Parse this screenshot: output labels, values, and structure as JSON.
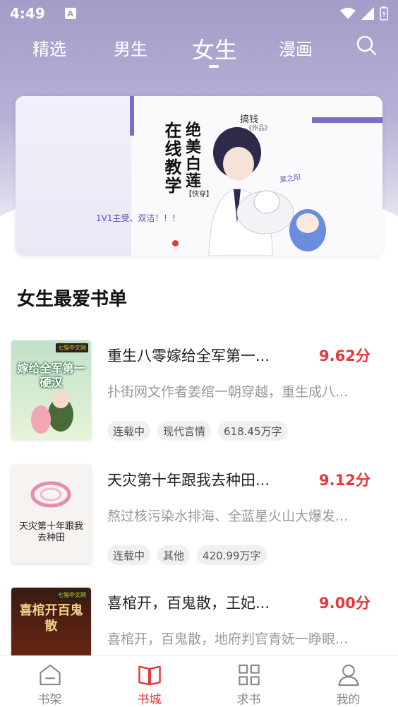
{
  "status": {
    "time": "4:49"
  },
  "top_tabs": [
    {
      "label": "精选"
    },
    {
      "label": "男生"
    },
    {
      "label": "女生"
    },
    {
      "label": "漫画"
    }
  ],
  "banner": {
    "author": "搞钱",
    "author_sub": "《作品》",
    "title_line1": "绝美白莲",
    "title_line2": "在线教学",
    "title_tag": "【快穿】",
    "pen_name": "莫之阳",
    "slogan": "1V1主受、双洁！！！"
  },
  "section": {
    "title": "女生最爱书单"
  },
  "books": [
    {
      "title": "重生八零嫁给全军第一...",
      "score": "9.62分",
      "desc": "扑街网文作者姜绾一朝穿越，重生成八...",
      "tags": [
        "连载中",
        "现代言情",
        "618.45万字"
      ],
      "cover_text": "嫁给全军第一硬汉",
      "cover_badge": "七猫中文网"
    },
    {
      "title": "天灾第十年跟我去种田...",
      "score": "9.12分",
      "desc": "熬过核污染水排海、全蓝星火山大爆发...",
      "tags": [
        "连载中",
        "其他",
        "420.99万字"
      ],
      "cover_text": "天灾第十年跟我去种田"
    },
    {
      "title": "喜棺开，百鬼散，王妃...",
      "score": "9.00分",
      "desc": "喜棺开，百鬼散，地府判官青妩一睁眼...",
      "tags": [],
      "cover_text": "喜棺开百鬼散",
      "cover_badge": "七猫中文网"
    }
  ],
  "bottom_nav": [
    {
      "label": "书架",
      "icon": "bookshelf-icon"
    },
    {
      "label": "书城",
      "icon": "book-open-icon"
    },
    {
      "label": "求书",
      "icon": "grid-icon"
    },
    {
      "label": "我的",
      "icon": "user-icon"
    }
  ],
  "colors": {
    "accent": "#e5383b",
    "banner_purple": "#7b6ec6",
    "header_bg": "#a59cc7"
  }
}
